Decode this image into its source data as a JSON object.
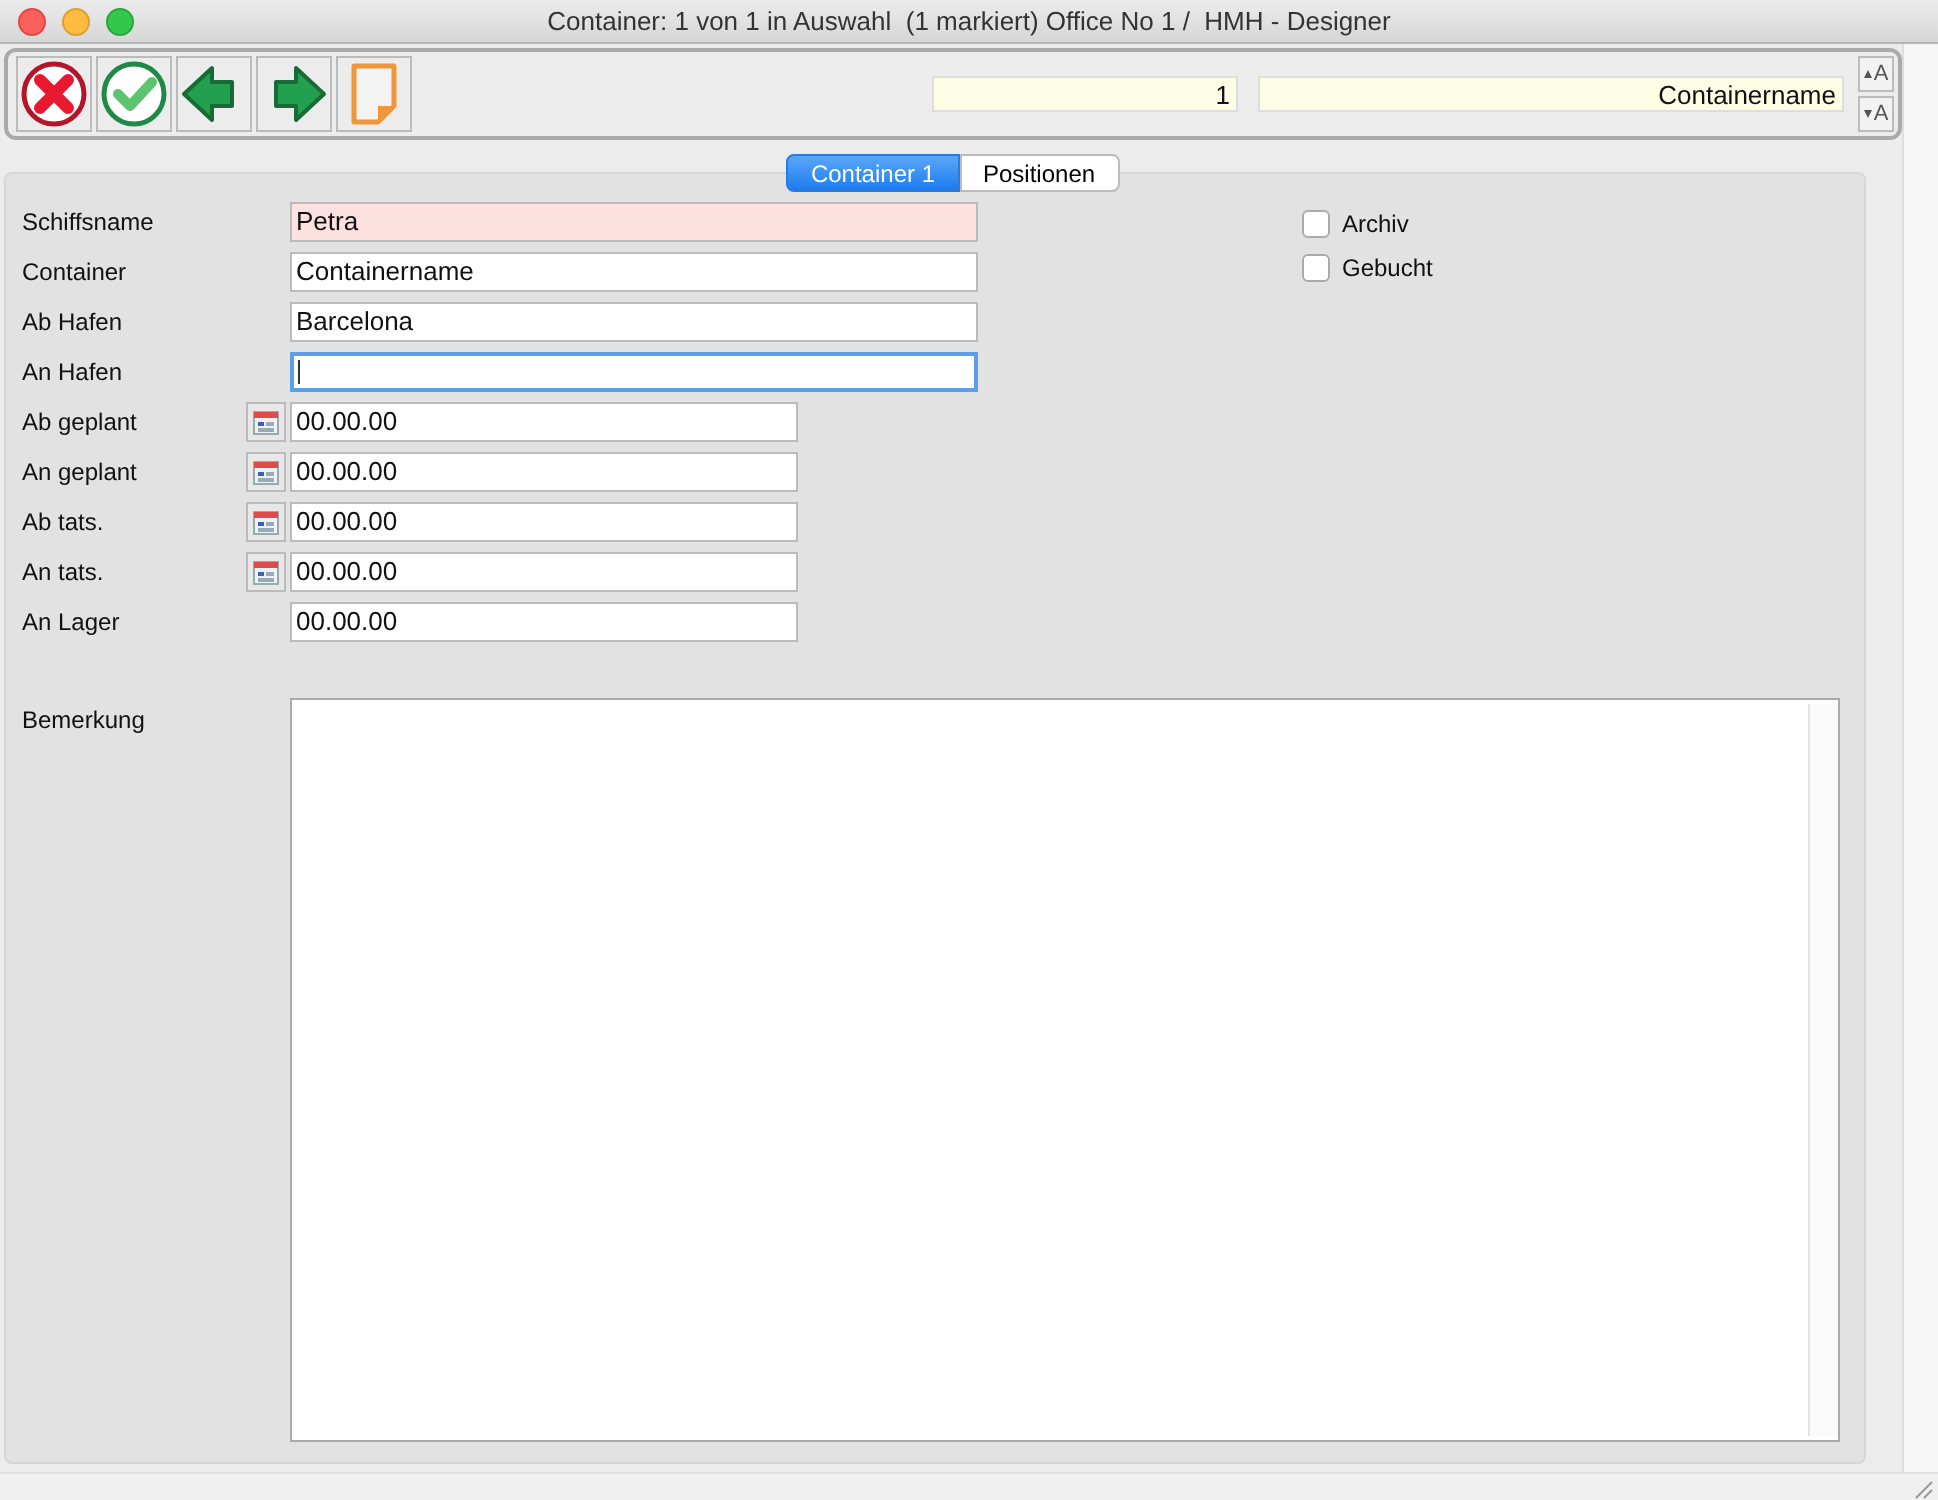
{
  "window": {
    "title": "Container: 1 von 1 in Auswahl  (1 markiert) Office No 1 /  HMH - Designer"
  },
  "toolbar": {
    "record_number": "1",
    "record_name": "Containername",
    "text_size_buttons": [
      {
        "label": "A",
        "kind": "increase"
      },
      {
        "label": "A",
        "kind": "decrease"
      }
    ]
  },
  "tabs": [
    {
      "label": "Container 1",
      "selected": true
    },
    {
      "label": "Positionen",
      "selected": false
    }
  ],
  "fields": [
    {
      "label": "Schiffsname",
      "kind": "text",
      "value": "Petra",
      "required": true,
      "focused": false
    },
    {
      "label": "Container",
      "kind": "text",
      "value": "Containername",
      "required": false,
      "focused": false
    },
    {
      "label": "Ab Hafen",
      "kind": "text",
      "value": "Barcelona",
      "required": false,
      "focused": false
    },
    {
      "label": "An Hafen",
      "kind": "text",
      "required": false,
      "focused": true
    },
    {
      "label": "Ab geplant",
      "kind": "date",
      "value": "00.00.00",
      "required": false,
      "focused": false
    },
    {
      "label": "An geplant",
      "kind": "date",
      "value": "00.00.00",
      "required": false,
      "focused": false
    },
    {
      "label": "Ab tats.",
      "kind": "date",
      "value": "00.00.00",
      "required": false,
      "focused": false
    },
    {
      "label": "An tats.",
      "kind": "date",
      "value": "00.00.00",
      "required": false,
      "focused": false
    },
    {
      "label": "An Lager",
      "kind": "plain-date",
      "value": "00.00.00",
      "required": false,
      "focused": false
    }
  ],
  "checkboxes": [
    {
      "label": "Archiv",
      "checked": false
    },
    {
      "label": "Gebucht",
      "checked": false
    }
  ],
  "remark": {
    "label": "Bemerkung"
  }
}
